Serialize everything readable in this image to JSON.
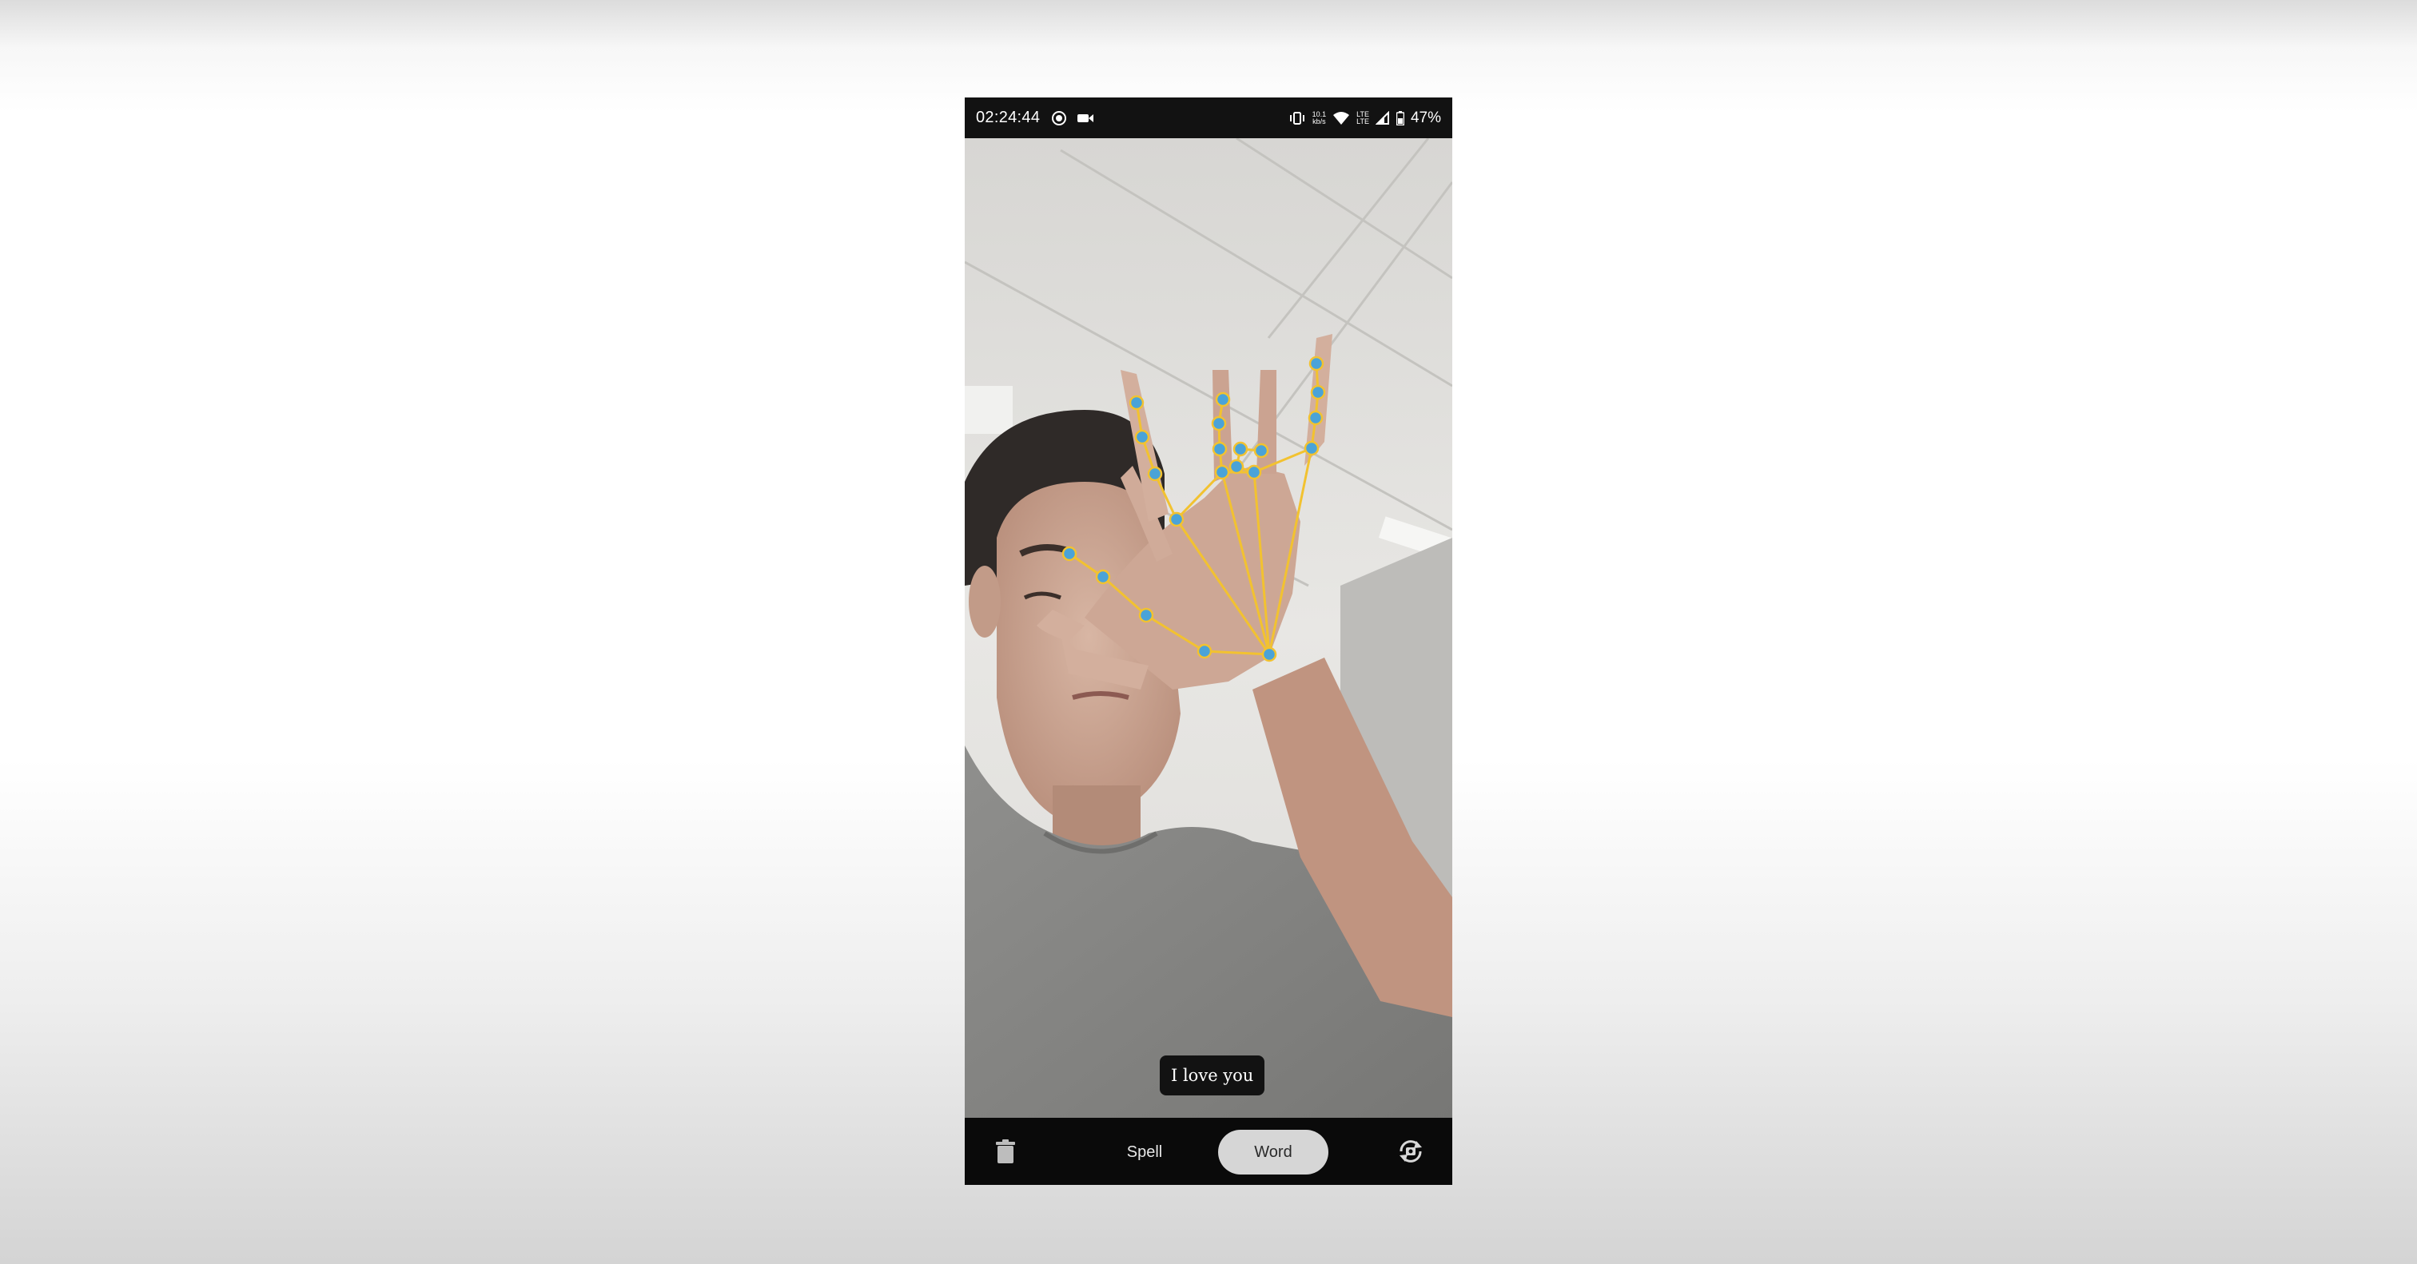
{
  "status_bar": {
    "time": "02:24:44",
    "left_icons": [
      "screen-record-icon",
      "video-camera-icon"
    ],
    "net_speed_value": "10.1",
    "net_speed_unit": "kb/s",
    "lte_top": "LTE",
    "lte_bottom": "LTE",
    "right_icons": [
      "vibrate-icon",
      "wifi-icon",
      "signal-icon",
      "battery-icon"
    ],
    "battery": "47%"
  },
  "camera": {
    "caption": "I love you",
    "landmark_color": "#4aa3d8",
    "skeleton_color": "#f2c230"
  },
  "bottom_bar": {
    "delete_icon": "trash-icon",
    "tabs": [
      "Spell",
      "Word"
    ],
    "selected_tab": "Word",
    "switch_camera_icon": "camera-switch-icon"
  }
}
